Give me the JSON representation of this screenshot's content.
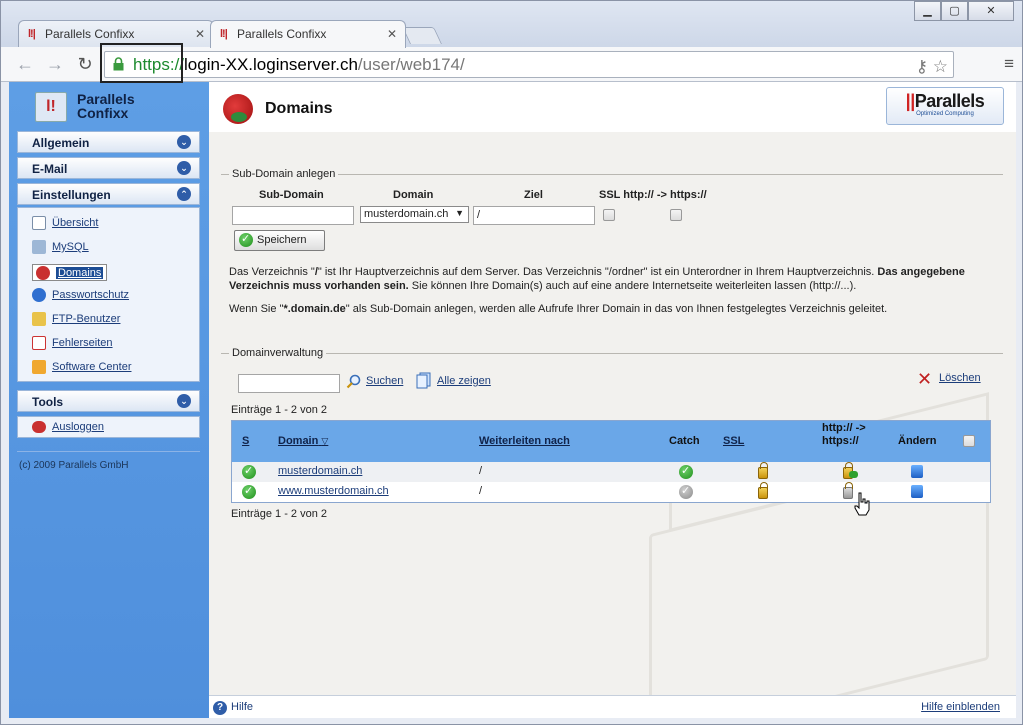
{
  "browser": {
    "tabs": [
      {
        "title": "Parallels Confixx",
        "active": false
      },
      {
        "title": "Parallels Confixx",
        "active": true
      }
    ],
    "url": {
      "scheme": "https://",
      "host": "login-XX.loginserver.ch",
      "path": "/user/web174/"
    }
  },
  "sidebar": {
    "logo_line1": "Parallels",
    "logo_line2": "Confixx",
    "sections": [
      {
        "label": "Allgemein",
        "chevron": "down"
      },
      {
        "label": "E-Mail",
        "chevron": "down"
      },
      {
        "label": "Einstellungen",
        "chevron": "up"
      },
      {
        "label": "Tools",
        "chevron": "down"
      }
    ],
    "items": [
      {
        "label": "Übersicht",
        "icon": "document-icon"
      },
      {
        "label": "MySQL",
        "icon": "dolphin-icon"
      },
      {
        "label": "Domains",
        "icon": "globe-flag-icon",
        "selected": true
      },
      {
        "label": "Passwortschutz",
        "icon": "padlock-icon"
      },
      {
        "label": "FTP-Benutzer",
        "icon": "folder-user-icon"
      },
      {
        "label": "Fehlerseiten",
        "icon": "error-page-icon"
      },
      {
        "label": "Software Center",
        "icon": "box-icon"
      }
    ],
    "logout": "Ausloggen",
    "copyright": "(c) 2009 Parallels GmbH"
  },
  "header": {
    "title": "Domains",
    "brand_name": "Parallels",
    "brand_tagline": "Optimized Computing"
  },
  "subdomain": {
    "legend": "Sub-Domain anlegen",
    "col_subdomain": "Sub-Domain",
    "col_domain": "Domain",
    "col_ziel": "Ziel",
    "col_ssl": "SSL http:// -> https://",
    "subdomain_value": "",
    "domain_selected": "musterdomain.ch",
    "ziel_value": "/",
    "save_label": "Speichern",
    "info1_a": "Das Verzeichnis \"",
    "info1_b": "/",
    "info1_c": "\" ist Ihr Hauptverzeichnis auf dem Server. Das Verzeichnis \"/ordner\" ist ein Unterordner in Ihrem Hauptverzeichnis. ",
    "info1_d": "Das angegebene Verzeichnis muss vorhanden sein.",
    "info1_e": " Sie können Ihre Domain(s) auch auf eine andere Internetseite weiterleiten lassen (http://...).",
    "info2_a": "Wenn Sie \"",
    "info2_b": "*.domain.de",
    "info2_c": "\" als Sub-Domain anlegen, werden alle Aufrufe Ihrer Domain in das von Ihnen festgelegtes Verzeichnis geleitet."
  },
  "verwaltung": {
    "legend": "Domainverwaltung",
    "search_value": "",
    "search_label": "Suchen",
    "show_all_label": "Alle zeigen",
    "delete_label": "Löschen",
    "entries_top": "Einträge 1 - 2 von 2",
    "entries_bottom": "Einträge 1 - 2 von 2",
    "columns": {
      "s": "S",
      "domain": "Domain",
      "weiter": "Weiterleiten nach",
      "catch": "Catch",
      "ssl": "SSL",
      "redirect": "http:// -> https://",
      "aendern": "Ändern"
    },
    "rows": [
      {
        "domain": "musterdomain.ch",
        "weiter": "/",
        "catch": "active"
      },
      {
        "domain": "www.musterdomain.ch",
        "weiter": "/",
        "catch": "inactive"
      }
    ]
  },
  "footer": {
    "help": "Hilfe",
    "show_help": "Hilfe einblenden"
  },
  "colors": {
    "sidebar": "#5e9ee5",
    "table_header": "#6aa7e8",
    "content_bg": "#f2f1ee",
    "link": "#1c3d7a"
  }
}
